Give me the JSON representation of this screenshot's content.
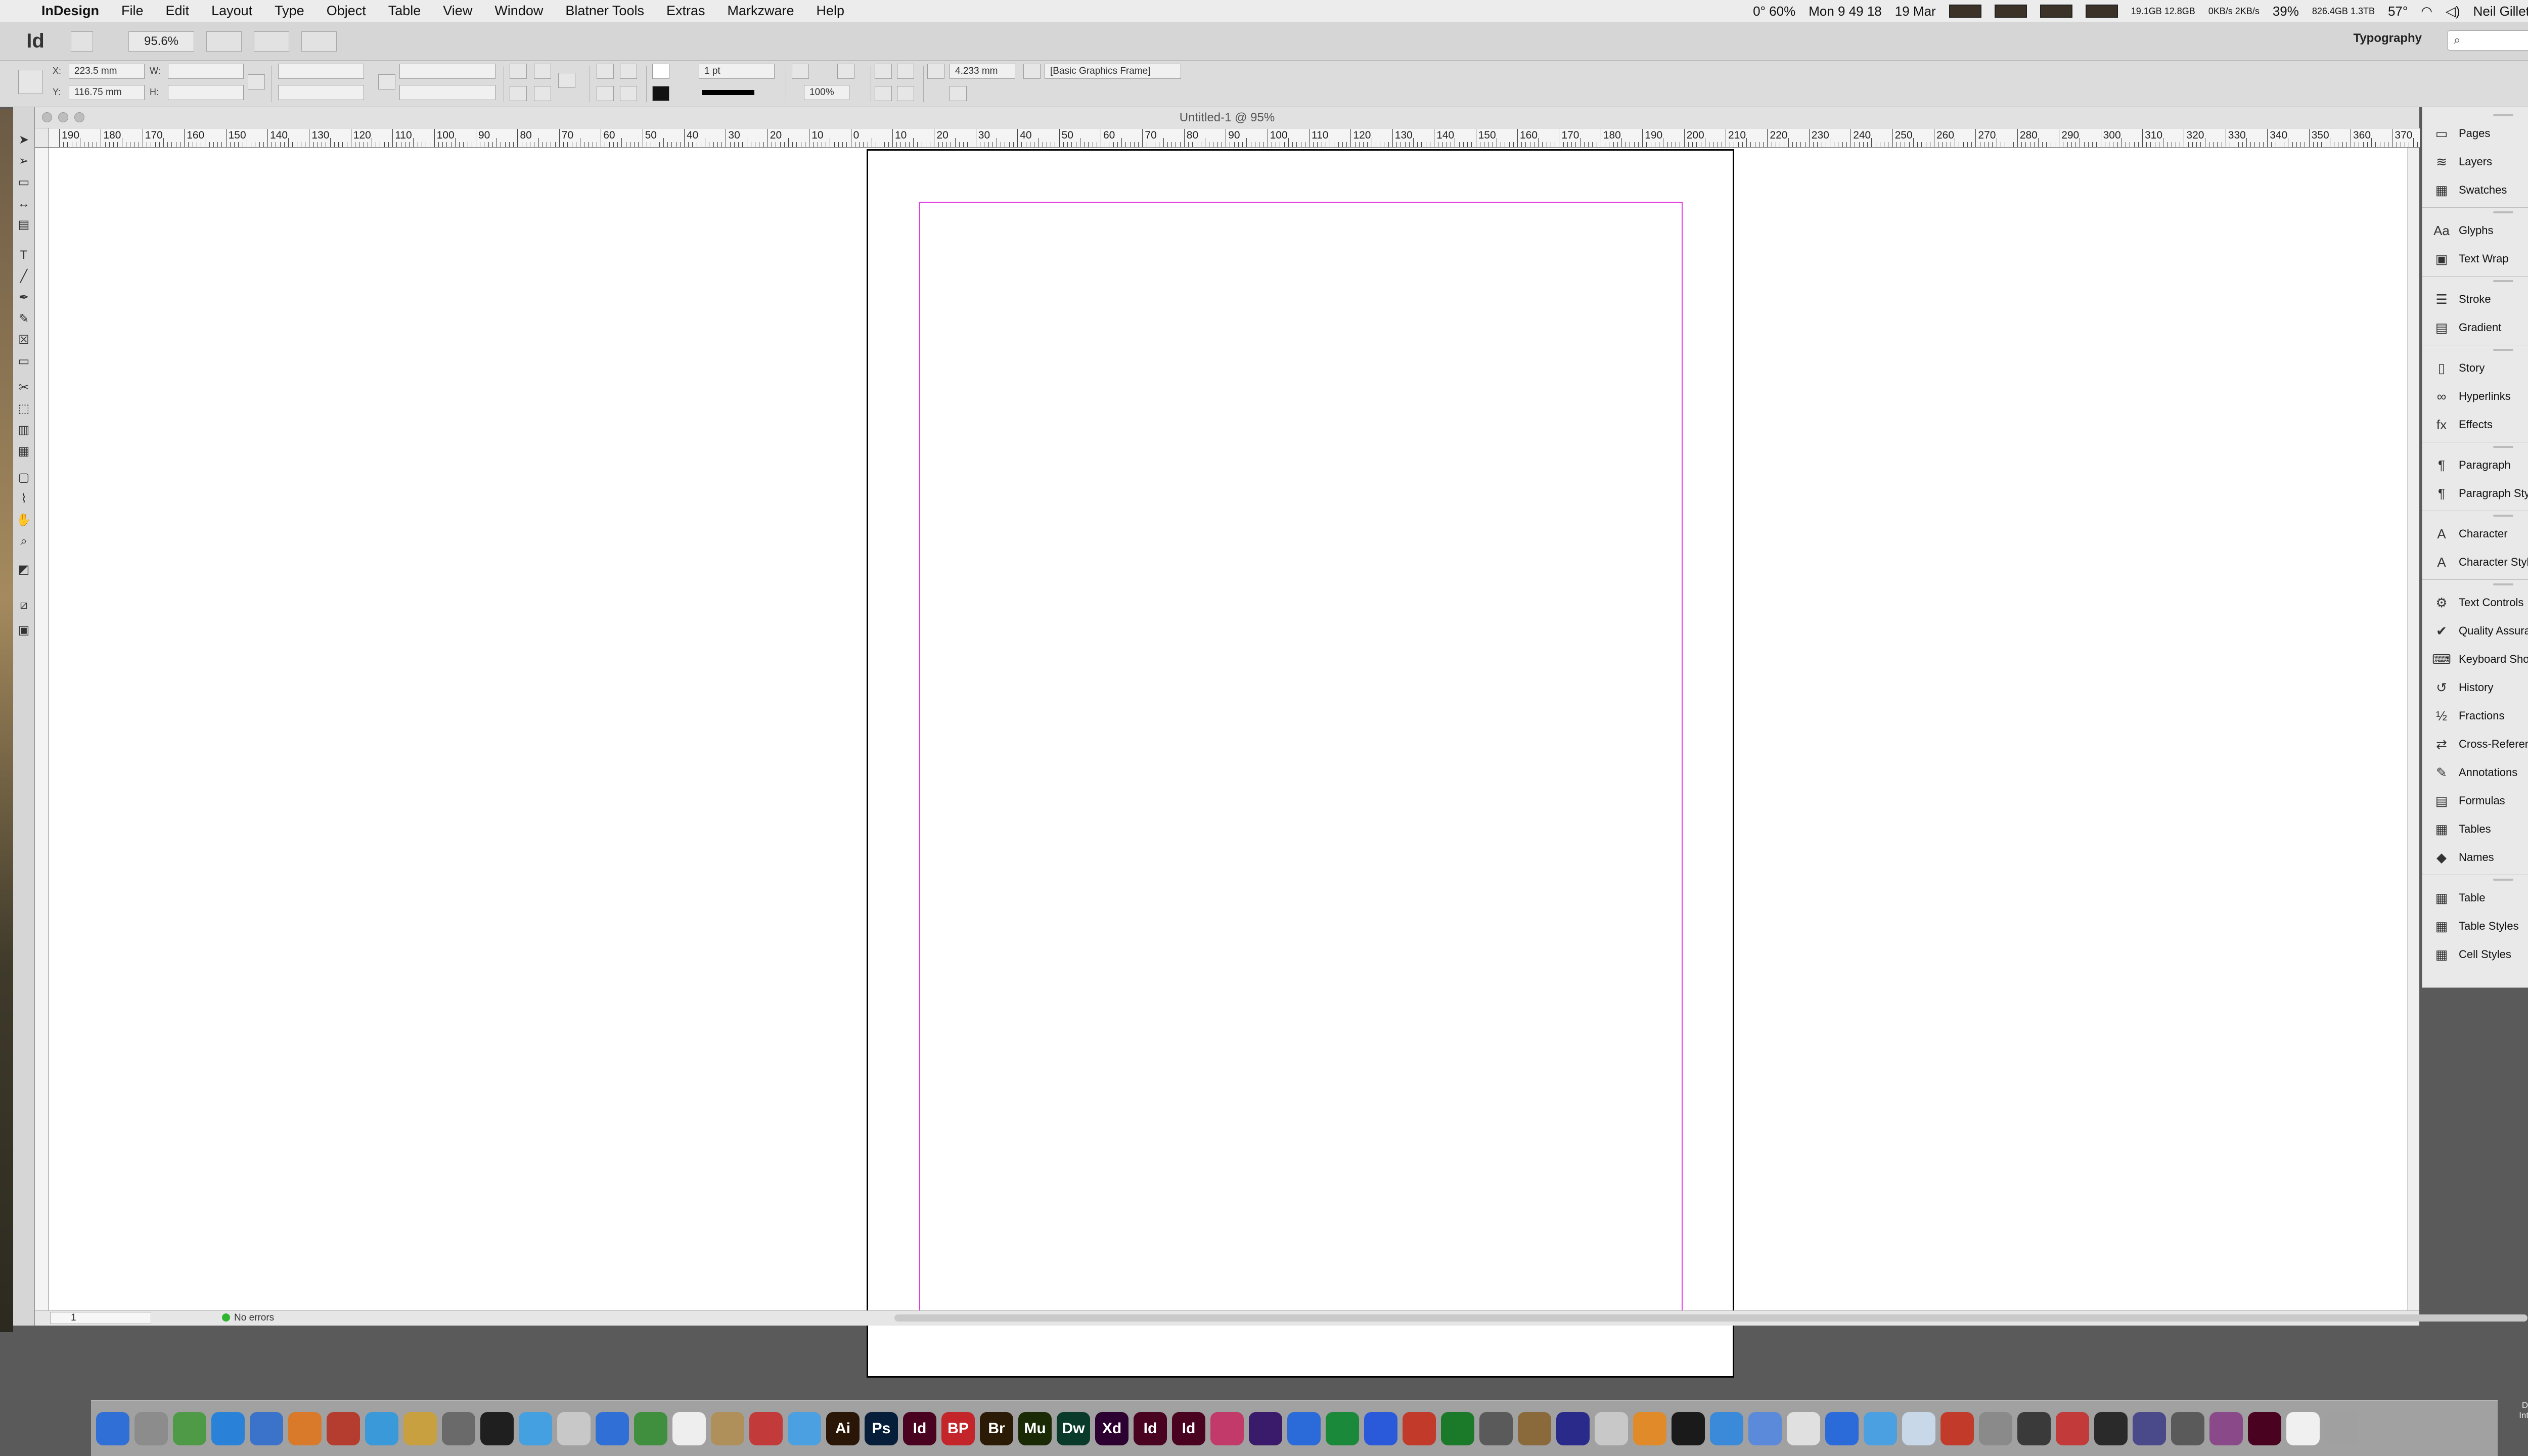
{
  "menubar": {
    "items": [
      "InDesign",
      "File",
      "Edit",
      "Layout",
      "Type",
      "Object",
      "Table",
      "View",
      "Window",
      "Blatner Tools",
      "Extras",
      "Markzware",
      "Help"
    ],
    "status": {
      "weather": "0° 60%",
      "clock": "Mon 9 49 18",
      "date": "19 Mar",
      "memory": "19.1GB 12.8GB",
      "network": "0KB/s 2KB/s",
      "battery": "39%",
      "disk": "826.4GB 1.3TB",
      "temp": "57°",
      "user": "Neil Gillett"
    }
  },
  "appbar": {
    "logo": "Id",
    "zoom": "95.6%",
    "workspace": "Typography",
    "search_placeholder": ""
  },
  "control": {
    "x_label": "X:",
    "x_value": "223.5 mm",
    "y_label": "Y:",
    "y_value": "116.75 mm",
    "w_label": "W:",
    "h_label": "H:",
    "stroke_weight": "1 pt",
    "opacity": "100%",
    "corner_size": "4.233 mm",
    "object_style": "[Basic Graphics Frame]"
  },
  "document": {
    "title": "Untitled-1 @ 95%",
    "page_field": "1",
    "preflight": "No errors",
    "ruler_labels": [
      "190",
      "180",
      "170",
      "160",
      "150",
      "140",
      "130",
      "120",
      "110",
      "100",
      "90",
      "80",
      "70",
      "60",
      "50",
      "40",
      "30",
      "20",
      "10",
      "0",
      "10",
      "20",
      "30",
      "40",
      "50",
      "60",
      "70",
      "80",
      "90",
      "100",
      "110",
      "120",
      "130",
      "140",
      "150",
      "160",
      "170",
      "180",
      "190",
      "200",
      "210",
      "220",
      "230",
      "240",
      "250",
      "260",
      "270",
      "280",
      "290",
      "300",
      "310",
      "320",
      "330",
      "340",
      "350",
      "360",
      "370"
    ]
  },
  "panels": [
    {
      "label": "Pages",
      "icon": "pages-icon",
      "glyph": "▭"
    },
    {
      "label": "Layers",
      "icon": "layers-icon",
      "glyph": "≋"
    },
    {
      "label": "Swatches",
      "icon": "swatches-icon",
      "glyph": "▦"
    },
    {
      "label": "Glyphs",
      "icon": "glyphs-icon",
      "glyph": "Aa"
    },
    {
      "label": "Text Wrap",
      "icon": "text-wrap-icon",
      "glyph": "▣"
    },
    {
      "label": "Stroke",
      "icon": "stroke-icon",
      "glyph": "☰"
    },
    {
      "label": "Gradient",
      "icon": "gradient-icon",
      "glyph": "▤"
    },
    {
      "label": "Story",
      "icon": "story-icon",
      "glyph": "▯"
    },
    {
      "label": "Hyperlinks",
      "icon": "hyperlinks-icon",
      "glyph": "∞"
    },
    {
      "label": "Effects",
      "icon": "effects-icon",
      "glyph": "fx"
    },
    {
      "label": "Paragraph",
      "icon": "paragraph-icon",
      "glyph": "¶"
    },
    {
      "label": "Paragraph Styles",
      "icon": "paragraph-styles-icon",
      "glyph": "¶"
    },
    {
      "label": "Character",
      "icon": "character-icon",
      "glyph": "A"
    },
    {
      "label": "Character Styles",
      "icon": "character-styles-icon",
      "glyph": "A"
    },
    {
      "label": "Text Controls",
      "icon": "text-controls-icon",
      "glyph": "⚙"
    },
    {
      "label": "Quality Assurance",
      "icon": "quality-assurance-icon",
      "glyph": "✔"
    },
    {
      "label": "Keyboard Shortcuts",
      "icon": "keyboard-shortcuts-icon",
      "glyph": "⌨"
    },
    {
      "label": "History",
      "icon": "history-icon",
      "glyph": "↺"
    },
    {
      "label": "Fractions",
      "icon": "fractions-icon",
      "glyph": "½"
    },
    {
      "label": "Cross-References Pro",
      "icon": "cross-references-icon",
      "glyph": "⇄"
    },
    {
      "label": "Annotations",
      "icon": "annotations-icon",
      "glyph": "✎"
    },
    {
      "label": "Formulas",
      "icon": "formulas-icon",
      "glyph": "▤"
    },
    {
      "label": "Tables",
      "icon": "tables-icon",
      "glyph": "▦"
    },
    {
      "label": "Names",
      "icon": "names-icon",
      "glyph": "◆"
    },
    {
      "label": "Table",
      "icon": "table-icon",
      "glyph": "▦"
    },
    {
      "label": "Table Styles",
      "icon": "table-styles-icon",
      "glyph": "▦"
    },
    {
      "label": "Cell Styles",
      "icon": "cell-styles-icon",
      "glyph": "▦"
    }
  ],
  "dock_apps": [
    {
      "label": "Ai",
      "color": "#2a1606"
    },
    {
      "label": "Ps",
      "color": "#061e3a"
    },
    {
      "label": "Id",
      "color": "#49021f"
    },
    {
      "label": "BP",
      "color": "#c4252b"
    },
    {
      "label": "Br",
      "color": "#2b1a05"
    },
    {
      "label": "Mu",
      "color": "#1a2a05"
    },
    {
      "label": "Dw",
      "color": "#0a3a2a"
    },
    {
      "label": "Xd",
      "color": "#2c0030"
    },
    {
      "label": "Id",
      "color": "#49021f"
    },
    {
      "label": "Id",
      "color": "#49021f"
    }
  ],
  "dropbox_label": "Dropbox Intelligible"
}
